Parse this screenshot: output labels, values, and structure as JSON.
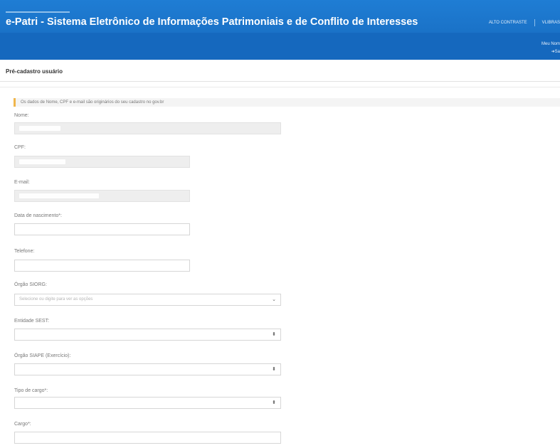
{
  "header": {
    "title": "e-Patri - Sistema Eletrônico de Informações Patrimoniais e de Conflito de Interesses",
    "links": [
      "ALTO CONTRASTE",
      "VLIBRAS"
    ],
    "user": [
      "Meu Nom",
      "Sa"
    ]
  },
  "page": {
    "title": "Pré-cadastro usuário"
  },
  "notice": "Os dados de Nome, CPF e e-mail são originários do seu cadastro no gov.br",
  "fields": {
    "nome": {
      "label": "Nome:"
    },
    "cpf": {
      "label": "CPF:"
    },
    "email": {
      "label": "E-mail:"
    },
    "nascimento": {
      "label": "Data de nascimento*:"
    },
    "telefone": {
      "label": "Telefone:"
    },
    "orgao_siorg": {
      "label": "Órgão SIORG:",
      "placeholder": "Selecione ou digite para ver as opções"
    },
    "entidade_sest": {
      "label": "Entidade SEST:"
    },
    "orgao_siape": {
      "label": "Órgão SIAPE (Exercício):"
    },
    "tipo_cargo": {
      "label": "Tipo de cargo*:"
    },
    "cargo": {
      "label": "Cargo*:"
    }
  },
  "icons": {
    "caret": "chevron-down-icon",
    "sort": "select-arrows-icon",
    "exit": "exit-icon"
  },
  "colors": {
    "header": "#1a73c9",
    "notice_accent": "#f0b64c",
    "readonly_bg": "#eeeeee"
  }
}
